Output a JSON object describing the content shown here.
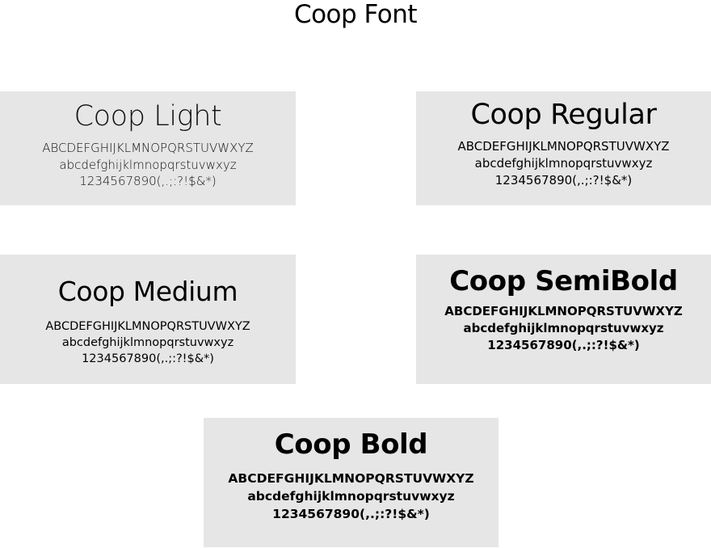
{
  "page": {
    "title": "Coop Font"
  },
  "cards": {
    "light": {
      "title": "Coop Light",
      "upper": "ABCDEFGHIJKLMNOPQRSTUVWXYZ",
      "lower": "abcdefghijklmnopqrstuvwxyz",
      "digits": "1234567890(,.;:?!$&*)"
    },
    "regular": {
      "title": "Coop Regular",
      "upper": "ABCDEFGHIJKLMNOPQRSTUVWXYZ",
      "lower": "abcdefghijklmnopqrstuvwxyz",
      "digits": "1234567890(,.;:?!$&*)"
    },
    "medium": {
      "title": "Coop Medium",
      "upper": "ABCDEFGHIJKLMNOPQRSTUVWXYZ",
      "lower": "abcdefghijklmnopqrstuvwxyz",
      "digits": "1234567890(,.;:?!$&*)"
    },
    "semibold": {
      "title": "Coop SemiBold",
      "upper": "ABCDEFGHIJKLMNOPQRSTUVWXYZ",
      "lower": "abcdefghijklmnopqrstuvwxyz",
      "digits": "1234567890(,.;:?!$&*)"
    },
    "bold": {
      "title": "Coop Bold",
      "upper": "ABCDEFGHIJKLMNOPQRSTUVWXYZ",
      "lower": "abcdefghijklmnopqrstuvwxyz",
      "digits": "1234567890(,.;:?!$&*)"
    }
  },
  "colors": {
    "card_background": "#e6e6e6",
    "page_background": "#ffffff",
    "text": "#000000"
  }
}
